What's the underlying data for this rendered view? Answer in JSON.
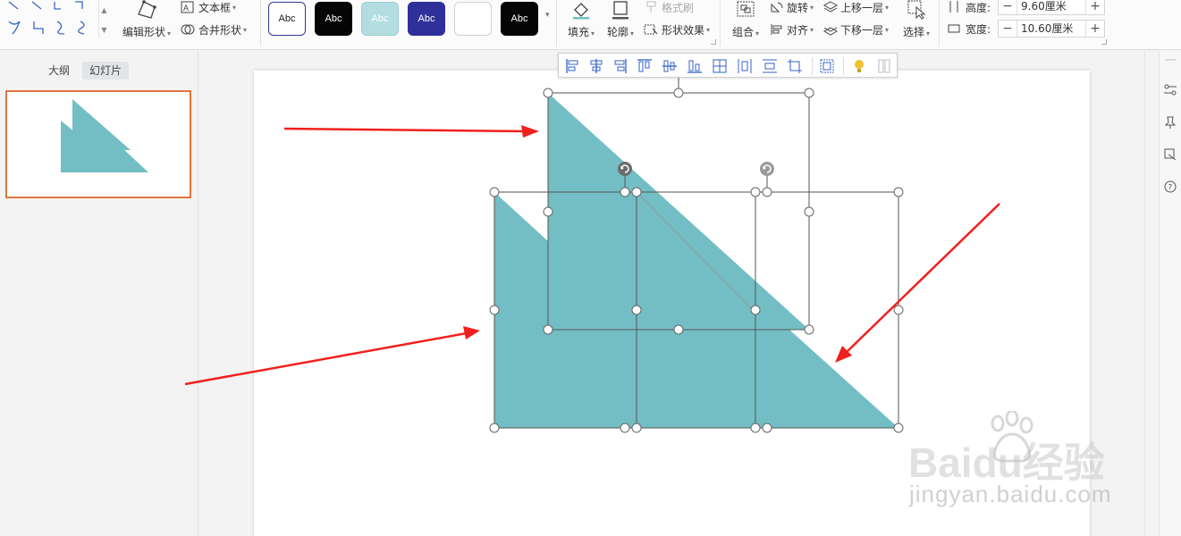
{
  "ribbon": {
    "edit_shape": "编辑形状",
    "text_box": "文本框",
    "merge_shape": "合并形状",
    "style_samples": [
      "Abc",
      "Abc",
      "Abc",
      "Abc",
      "",
      "Abc"
    ],
    "fill": "填充",
    "outline": "轮廓",
    "format_painter": "格式刷",
    "shape_effect": "形状效果",
    "group": "组合",
    "rotate": "旋转",
    "align": "对齐",
    "bring_forward": "上移一层",
    "send_backward": "下移一层",
    "select": "选择",
    "height_label": "高度:",
    "height_value": "9.60厘米",
    "width_label": "宽度:",
    "width_value": "10.60厘米",
    "minus": "−",
    "plus": "+"
  },
  "panel": {
    "tab_outline": "大纲",
    "tab_slides": "幻灯片"
  },
  "watermark": {
    "brand_text": "Baidu经验",
    "url": "jingyan.baidu.com"
  },
  "colors": {
    "shape_fill": "#72bec4",
    "arrow_red": "#f0201c",
    "thumb_border": "#e0743c",
    "accent_blue": "#3561c9"
  },
  "icons": {
    "fill": "paint-bucket-icon",
    "outline": "shape-outline-icon",
    "select": "cursor-select-icon",
    "idea": "lightbulb-icon"
  }
}
